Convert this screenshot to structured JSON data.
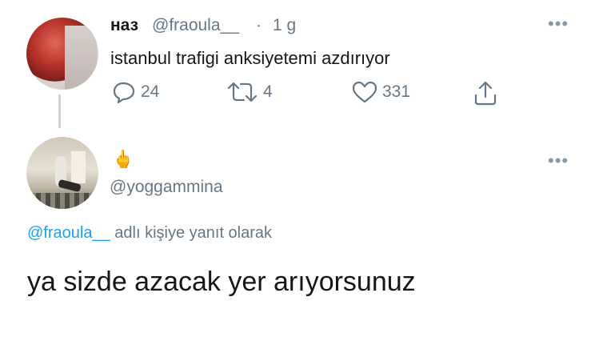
{
  "parent_tweet": {
    "name": "наз",
    "handle": "@fraoula__",
    "separator": "·",
    "time": "1 g",
    "text": "istanbul trafigi anksiyetemi azdırıyor",
    "replies": "24",
    "retweets": "4",
    "likes": "331",
    "more_label": "•••"
  },
  "reply_tweet": {
    "name_emoji": "🖕",
    "handle": "@yoggammina",
    "more_label": "•••",
    "replying_to_mention": "@fraoula__",
    "replying_to_suffix": "adlı kişiye yanıt olarak",
    "text": "ya sizde azacak yer arıyorsunuz"
  },
  "colors": {
    "accent": "#1da1f2",
    "secondary_text": "#657786",
    "primary_text": "#14171a",
    "thread_line": "#ccd6dd"
  },
  "icons": {
    "reply": "reply-icon",
    "retweet": "retweet-icon",
    "like": "heart-icon",
    "share": "share-icon",
    "more": "more-icon"
  }
}
